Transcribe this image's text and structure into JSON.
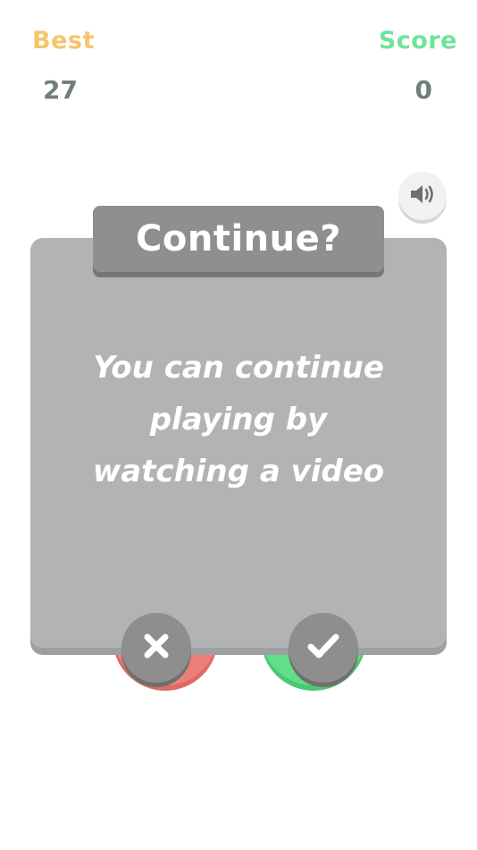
{
  "hud": {
    "best_label": "Best",
    "best_value": "27",
    "score_label": "Score",
    "score_value": "0"
  },
  "dialog": {
    "title": "Continue?",
    "message_lines": [
      "You can continue",
      "playing by",
      "watching a video"
    ]
  },
  "icons": {
    "sound": "speaker-icon",
    "decline": "close-icon",
    "accept": "checkmark-icon"
  },
  "colors": {
    "best": "#f7c46b",
    "score": "#6fe39a",
    "hud_value": "#6f7f78",
    "dialog_body": "#b1b3b4",
    "dialog_header": "#8f8f8f",
    "decline_button": "#ec7f7b",
    "accept_button": "#61df88"
  }
}
